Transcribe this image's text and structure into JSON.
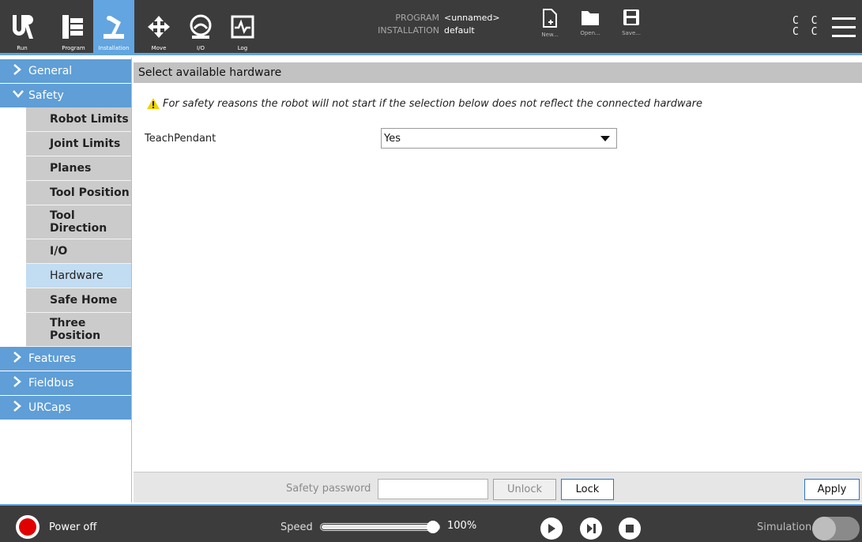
{
  "topbar": {
    "tabs": [
      {
        "label": "Run",
        "icon": "ur-logo-icon"
      },
      {
        "label": "Program",
        "icon": "program-icon"
      },
      {
        "label": "Installation",
        "icon": "installation-icon",
        "active": true
      },
      {
        "label": "Move",
        "icon": "move-icon"
      },
      {
        "label": "I/O",
        "icon": "io-icon"
      },
      {
        "label": "Log",
        "icon": "log-icon"
      }
    ],
    "program_key": "PROGRAM",
    "program_value": "<unnamed>",
    "installation_key": "INSTALLATION",
    "installation_value": "default",
    "file_buttons": [
      {
        "label": "New...",
        "icon": "new-file-icon"
      },
      {
        "label": "Open...",
        "icon": "folder-icon"
      },
      {
        "label": "Save...",
        "icon": "save-icon"
      }
    ],
    "status_code": "C C C C",
    "menu_icon": "hamburger-menu-icon"
  },
  "sidebar": {
    "sections": [
      {
        "label": "General",
        "expanded": false
      },
      {
        "label": "Safety",
        "expanded": true
      },
      {
        "label": "Features",
        "expanded": false
      },
      {
        "label": "Fieldbus",
        "expanded": false
      },
      {
        "label": "URCaps",
        "expanded": false
      }
    ],
    "safety_items": [
      {
        "label": "Robot Limits"
      },
      {
        "label": "Joint Limits"
      },
      {
        "label": "Planes"
      },
      {
        "label": "Tool Position"
      },
      {
        "label": "Tool Direction"
      },
      {
        "label": "I/O"
      },
      {
        "label": "Hardware",
        "selected": true
      },
      {
        "label": "Safe Home"
      },
      {
        "label": "Three Position"
      }
    ]
  },
  "main": {
    "header": "Select available hardware",
    "warning": "For safety reasons the robot will not start if the selection below does not reflect the connected hardware",
    "teach_pendant_label": "TeachPendant",
    "teach_pendant_value": "Yes"
  },
  "safety_bar": {
    "password_label": "Safety password",
    "password_value": "",
    "unlock_label": "Unlock",
    "lock_label": "Lock",
    "apply_label": "Apply"
  },
  "footer": {
    "power_label": "Power off",
    "speed_label": "Speed",
    "speed_value": "100%",
    "speed_fraction": 1.0,
    "simulation_label": "Simulation",
    "simulation_on": false
  },
  "colors": {
    "accent": "#62a5e0",
    "section_bg": "#5f9ed6",
    "selected_item": "#c2dcf2",
    "power_red": "#e00000"
  }
}
